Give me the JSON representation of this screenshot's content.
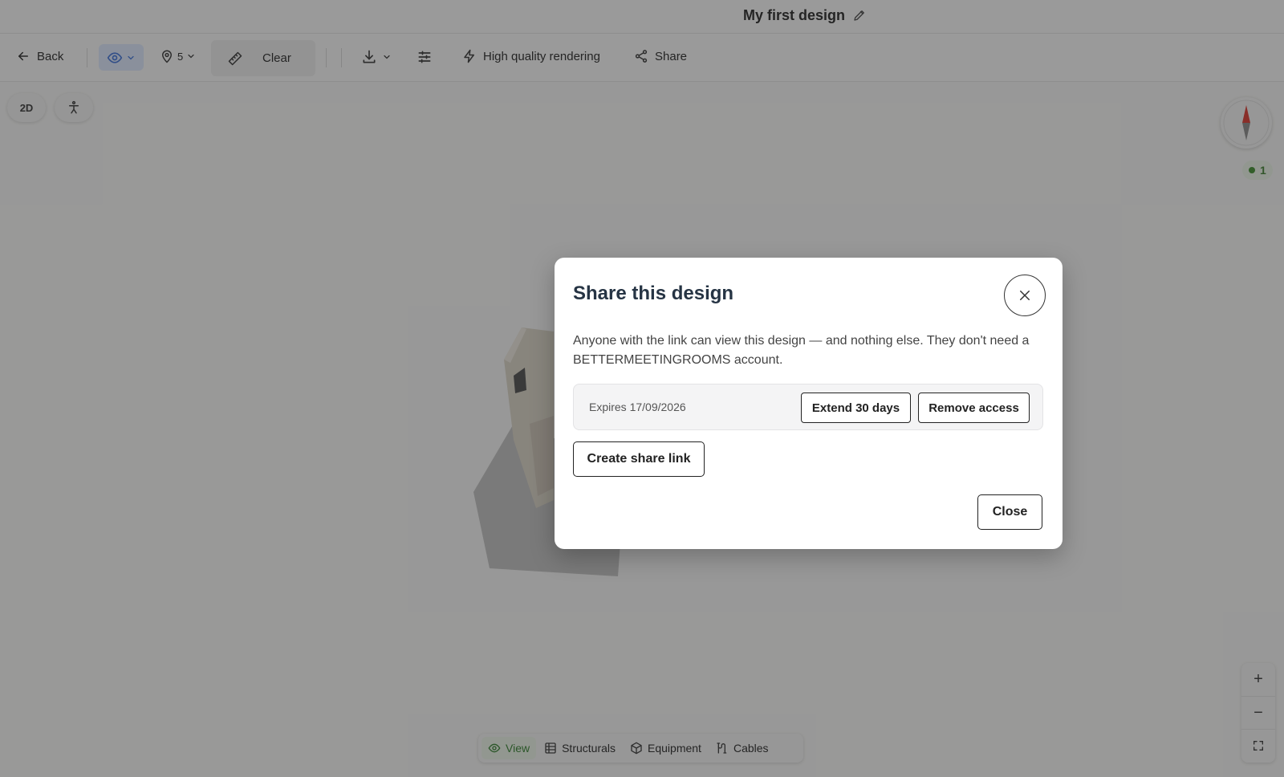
{
  "header": {
    "title": "My first design"
  },
  "toolbar": {
    "back_label": "Back",
    "pin_count": "5",
    "clear_label": "Clear",
    "hq_label": "High quality rendering",
    "share_label": "Share"
  },
  "canvas": {
    "mode_2d_label": "2D",
    "badge_count": "1"
  },
  "bottom_tabs": [
    {
      "label": "View",
      "icon": "eye-icon",
      "active": true
    },
    {
      "label": "Structurals",
      "icon": "grid-icon",
      "active": false
    },
    {
      "label": "Equipment",
      "icon": "box-icon",
      "active": false
    },
    {
      "label": "Cables",
      "icon": "cable-icon",
      "active": false
    }
  ],
  "zoom": {
    "in": "+",
    "out": "−"
  },
  "modal": {
    "title": "Share this design",
    "description": "Anyone with the link can view this design — and nothing else. They don't need a BETTERMEETINGROOMS account.",
    "expires": "Expires 17/09/2026",
    "extend_label": "Extend 30 days",
    "remove_label": "Remove access",
    "create_label": "Create share link",
    "close_label": "Close"
  },
  "colors": {
    "accent_green": "#2e7d2a",
    "eye_button_bg": "#dbe6fb",
    "modal_title": "#263444"
  }
}
